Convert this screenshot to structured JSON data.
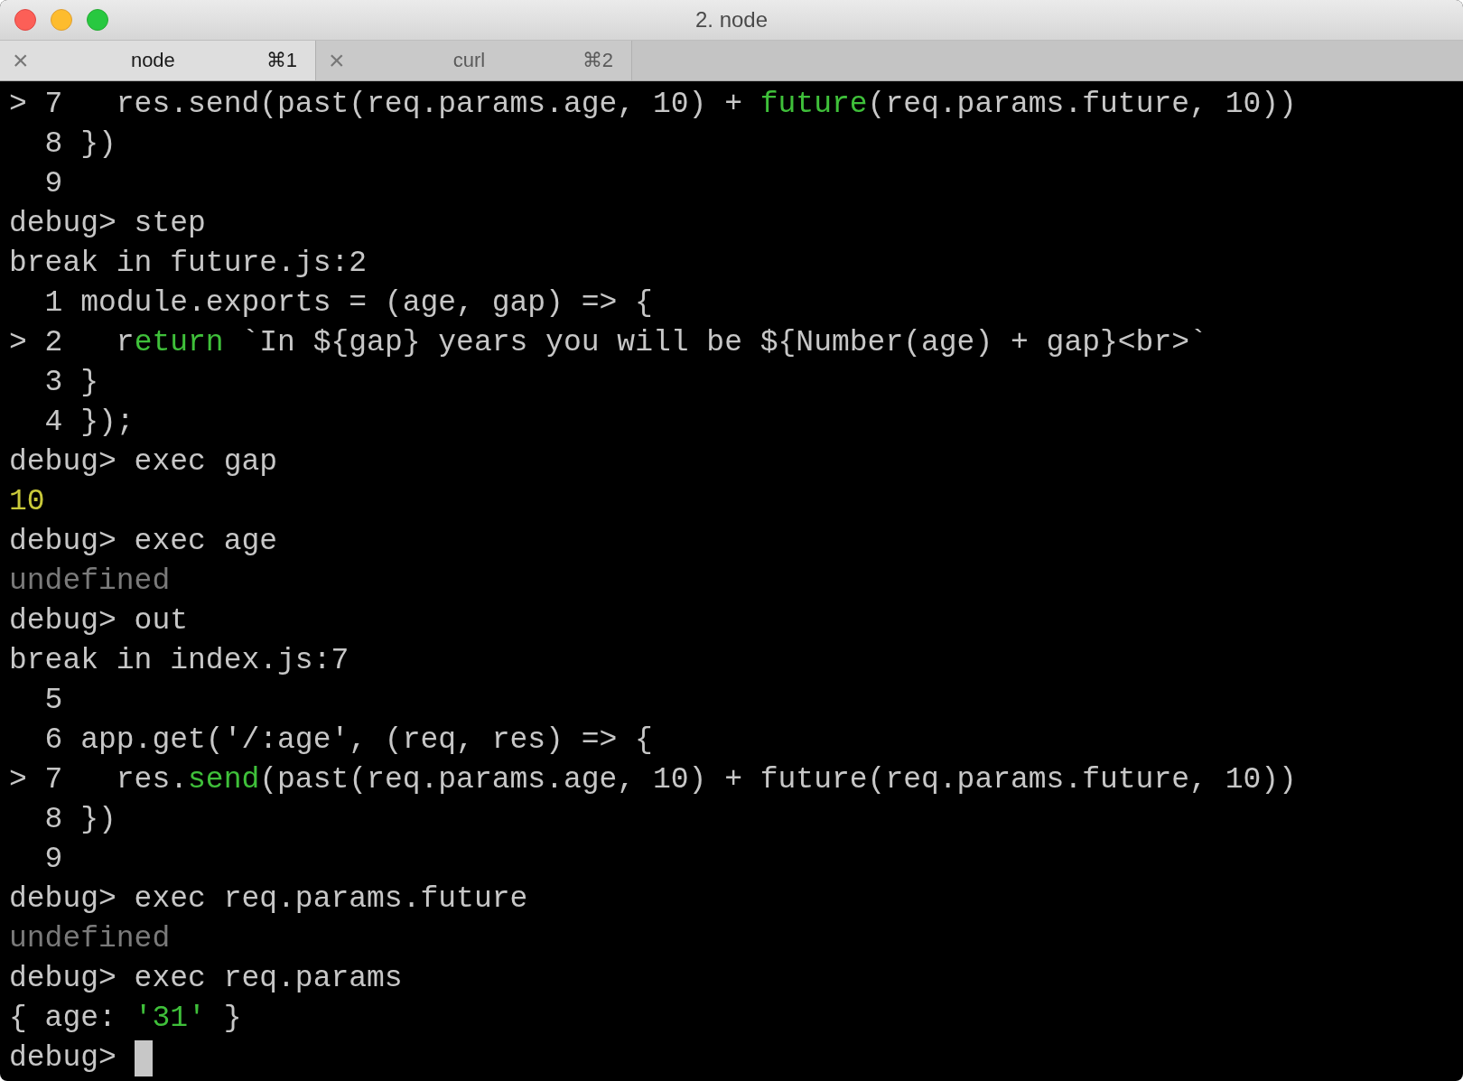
{
  "window": {
    "title": "2. node"
  },
  "tabs": [
    {
      "label": "node",
      "shortcut": "⌘1",
      "close": "×",
      "selected": true
    },
    {
      "label": "curl",
      "shortcut": "⌘2",
      "close": "×",
      "selected": false
    }
  ],
  "terminal": {
    "lines": [
      [
        {
          "text": "> 7   res.send(past(req.params.age, 10) + ",
          "kind": "plain"
        },
        {
          "text": "future",
          "kind": "green"
        },
        {
          "text": "(req.params.future, 10))",
          "kind": "plain"
        }
      ],
      [
        {
          "text": "  8 })",
          "kind": "plain"
        }
      ],
      [
        {
          "text": "  9",
          "kind": "plain"
        }
      ],
      [
        {
          "text": "debug> step",
          "kind": "plain"
        }
      ],
      [
        {
          "text": "break in future.js:2",
          "kind": "plain"
        }
      ],
      [
        {
          "text": "  1 module.exports = (age, gap) => {",
          "kind": "plain"
        }
      ],
      [
        {
          "text": "> 2   r",
          "kind": "plain"
        },
        {
          "text": "eturn",
          "kind": "green"
        },
        {
          "text": " `In ${gap} years you will be ${Number(age) + gap}<br>`",
          "kind": "plain"
        }
      ],
      [
        {
          "text": "  3 }",
          "kind": "plain"
        }
      ],
      [
        {
          "text": "  4 });",
          "kind": "plain"
        }
      ],
      [
        {
          "text": "debug> exec gap",
          "kind": "plain"
        }
      ],
      [
        {
          "text": "10",
          "kind": "yellow"
        }
      ],
      [
        {
          "text": "debug> exec age",
          "kind": "plain"
        }
      ],
      [
        {
          "text": "undefined",
          "kind": "grey"
        }
      ],
      [
        {
          "text": "debug> out",
          "kind": "plain"
        }
      ],
      [
        {
          "text": "break in index.js:7",
          "kind": "plain"
        }
      ],
      [
        {
          "text": "  5",
          "kind": "plain"
        }
      ],
      [
        {
          "text": "  6 app.get('/:age', (req, res) => {",
          "kind": "plain"
        }
      ],
      [
        {
          "text": "> 7   res.",
          "kind": "plain"
        },
        {
          "text": "send",
          "kind": "green"
        },
        {
          "text": "(past(req.params.age, 10) + future(req.params.future, 10))",
          "kind": "plain"
        }
      ],
      [
        {
          "text": "  8 })",
          "kind": "plain"
        }
      ],
      [
        {
          "text": "  9",
          "kind": "plain"
        }
      ],
      [
        {
          "text": "debug> exec req.params.future",
          "kind": "plain"
        }
      ],
      [
        {
          "text": "undefined",
          "kind": "grey"
        }
      ],
      [
        {
          "text": "debug> exec req.params",
          "kind": "plain"
        }
      ],
      [
        {
          "text": "{ age: ",
          "kind": "plain"
        },
        {
          "text": "'31'",
          "kind": "green"
        },
        {
          "text": " }",
          "kind": "plain"
        }
      ],
      [
        {
          "text": "debug> ",
          "kind": "plain"
        }
      ]
    ],
    "cursor": true
  }
}
